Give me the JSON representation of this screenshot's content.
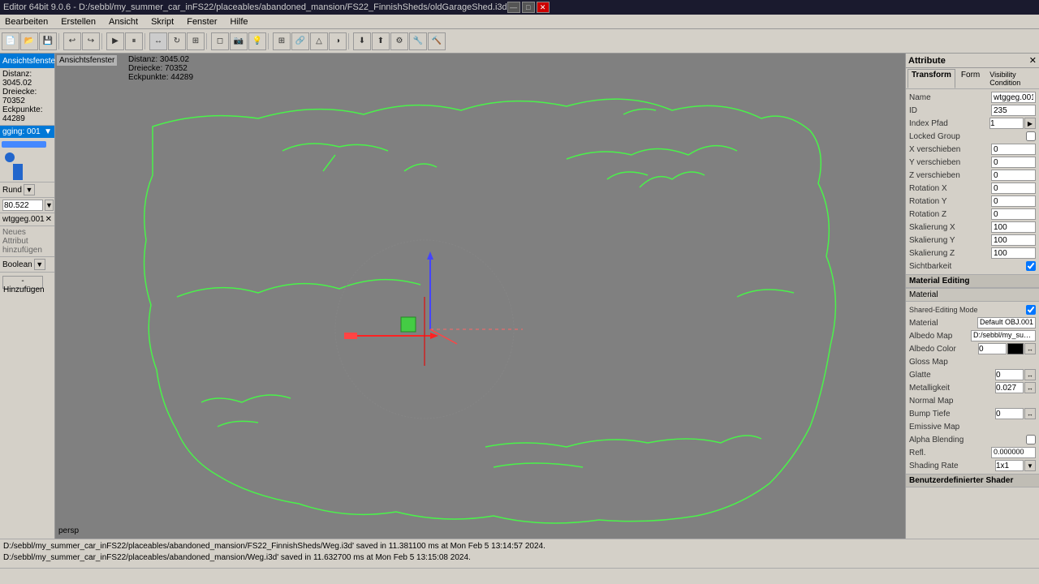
{
  "titlebar": {
    "title": "Editor 64bit 9.0.6 - D:/sebbl/my_summer_car_inFS22/placeables/abandoned_mansion/FS22_FinnishSheds/oldGarageShed.i3d",
    "minimize": "—",
    "maximize": "□",
    "close": "✕"
  },
  "menubar": {
    "items": [
      "Bearbeiten",
      "Erstellen",
      "Ansicht",
      "Skript",
      "Fenster",
      "Hilfe"
    ]
  },
  "leftpanel": {
    "header": "Ansichtsfenster",
    "close_btn": "✕",
    "distance_label": "Distanz: 3045.02",
    "triangles_label": "Dreiecke: 70352",
    "vertices_label": "Eckpunkte: 44289",
    "tab_label": "gging: 001",
    "shape_label": "Rund",
    "zoom_value": "80.522",
    "item_label": "wtggeg.001",
    "add_btn_label": "Neues Attribut hinzufügen",
    "dropdown_type": "Boolean",
    "add_btn2_label": "-Hinzufügen"
  },
  "viewport": {
    "label": "Ansichtsfenster",
    "persp": "persp",
    "info_distance": "Distanz: 3045.02",
    "info_triangles": "Dreiecke: 70352",
    "info_vertices": "Eckpunkte: 44289"
  },
  "rightpanel": {
    "header": "Attribute",
    "close": "✕",
    "tabs": [
      "Transform",
      "Form",
      "Visibility Condition"
    ],
    "active_tab": "Transform",
    "fields": {
      "name_label": "Name",
      "name_value": "wtggeg.001",
      "id_label": "ID",
      "id_value": "235",
      "index_pfad_label": "Index Pfad",
      "index_pfad_value": "1▶",
      "locked_group_label": "Locked Group",
      "x_verschieben_label": "X verschieben",
      "x_verschieben_value": "0",
      "y_verschieben_label": "Y verschieben",
      "y_verschieben_value": "0",
      "z_verschieben_label": "Z verschieben",
      "z_verschieben_value": "0",
      "rotation_x_label": "Rotation X",
      "rotation_x_value": "0",
      "rotation_y_label": "Rotation Y",
      "rotation_y_value": "0",
      "rotation_z_label": "Rotation Z",
      "rotation_z_value": "0",
      "skalierung_x_label": "Skalierung X",
      "skalierung_x_value": "100",
      "skalierung_y_label": "Skalierung Y",
      "skalierung_y_value": "100",
      "skalierung_z_label": "Skalierung Z",
      "skalierung_z_value": "100",
      "sichtbarkeit_label": "Sichtbarkeit"
    },
    "material_editing": {
      "section_title": "Material Editing",
      "material_title": "Material",
      "shared_editing_mode_label": "Shared-Editing Mode",
      "material_label": "Material",
      "material_value": "Default OBJ.001",
      "albedo_map_label": "Albedo Map",
      "albedo_map_value": "D:/sebbl/my_summ",
      "albedo_color_label": "Albedo Color",
      "albedo_color_value": "0",
      "gloss_map_label": "Gloss Map",
      "glatte_label": "Glatte",
      "glatte_value": "0",
      "metalligkeit_label": "Metalligkeit",
      "metalligkeit_value": "0.027",
      "normal_map_label": "Normal Map",
      "bump_tiefe_label": "Bump Tiefe",
      "bump_tiefe_value": "0",
      "emissive_map_label": "Emissive Map",
      "alpha_blending_label": "Alpha Blending",
      "refl_label": "Refl.",
      "refl_value": "0.000000",
      "shading_rate_label": "Shading Rate",
      "shading_rate_value": "1x1",
      "custom_shader_title": "Benutzerdefinierter Shader"
    }
  },
  "statusbar": {
    "line1": "D:/sebbl/my_summer_car_inFS22/placeables/abandoned_mansion/FS22_FinnishSheds/Weg.i3d' saved in 11.381100 ms at Mon Feb  5 13:14:57 2024.",
    "line2": "D:/sebbl/my_summer_car_inFS22/placeables/abandoned_mansion/Weg.i3d' saved in 11.632700 ms at Mon Feb  5 13:15:08 2024."
  },
  "condition_label": "Condition"
}
